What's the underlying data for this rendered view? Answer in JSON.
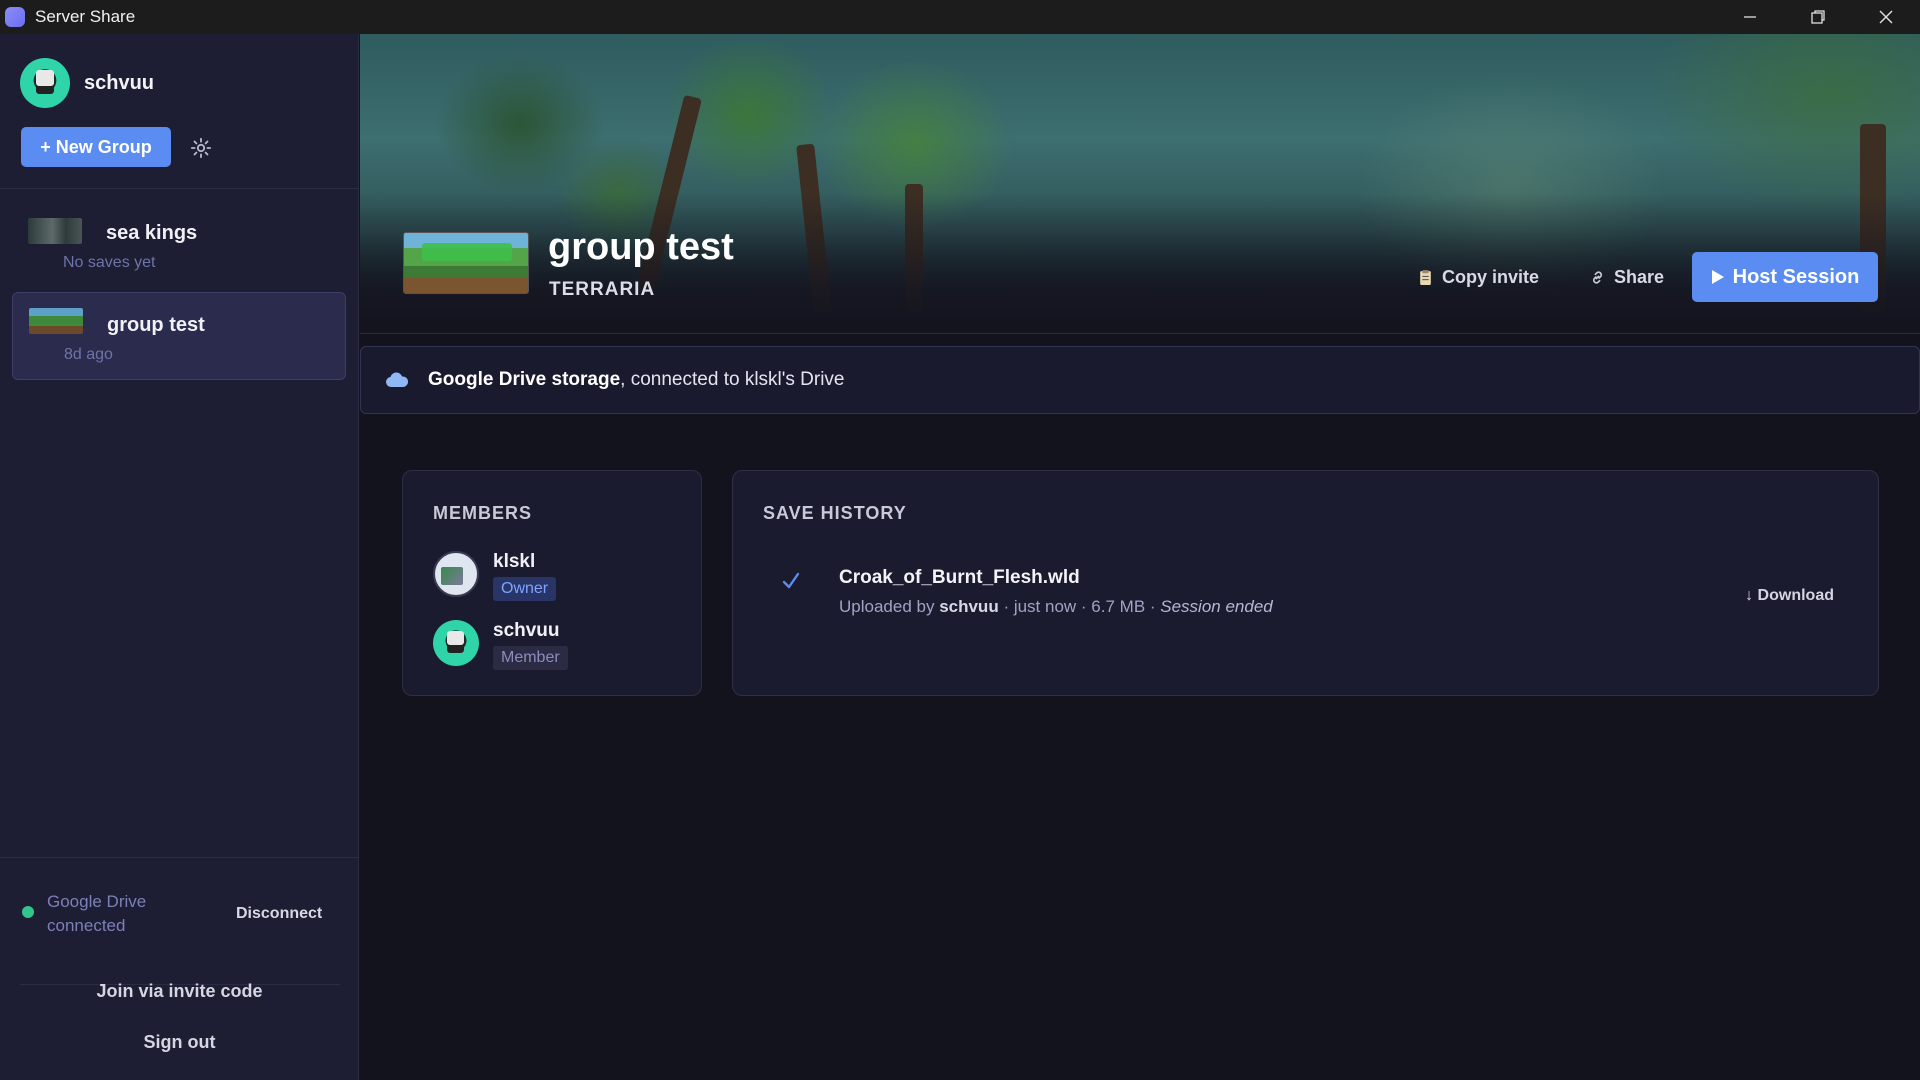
{
  "window": {
    "title": "Server Share"
  },
  "sidebar": {
    "username": "schvuu",
    "new_group_label": "+ New Group",
    "groups": [
      {
        "name": "sea kings",
        "subtitle": "No saves yet"
      },
      {
        "name": "group test",
        "subtitle": "8d ago"
      }
    ],
    "drive_status": "Google Drive connected",
    "disconnect_label": "Disconnect",
    "join_label": "Join via invite code",
    "signout_label": "Sign out"
  },
  "header": {
    "group_title": "group test",
    "game": "TERRARIA",
    "copy_invite_label": "Copy invite",
    "share_label": "Share",
    "host_label": "Host Session"
  },
  "storage": {
    "bold": "Google Drive storage",
    "rest": ", connected to klskl's Drive"
  },
  "members": {
    "title": "MEMBERS",
    "list": [
      {
        "name": "klskl",
        "role": "Owner"
      },
      {
        "name": "schvuu",
        "role": "Member"
      }
    ]
  },
  "save_history": {
    "title": "SAVE HISTORY",
    "items": [
      {
        "file": "Croak_of_Burnt_Flesh.wld",
        "meta_prefix": "Uploaded by ",
        "uploader": "schvuu",
        "meta_mid": " · just now · 6.7 MB · ",
        "status": "Session ended",
        "download_label": "↓ Download"
      }
    ]
  },
  "colors": {
    "accent": "#5b8cf2",
    "sidebar_bg": "#1d1d33",
    "main_bg": "#13131e",
    "status_green": "#31c48d"
  },
  "icons": [
    "app-icon",
    "minimize-icon",
    "restore-icon",
    "close-icon",
    "gear-icon",
    "clipboard-icon",
    "link-icon",
    "play-icon",
    "cloud-icon",
    "check-icon"
  ]
}
